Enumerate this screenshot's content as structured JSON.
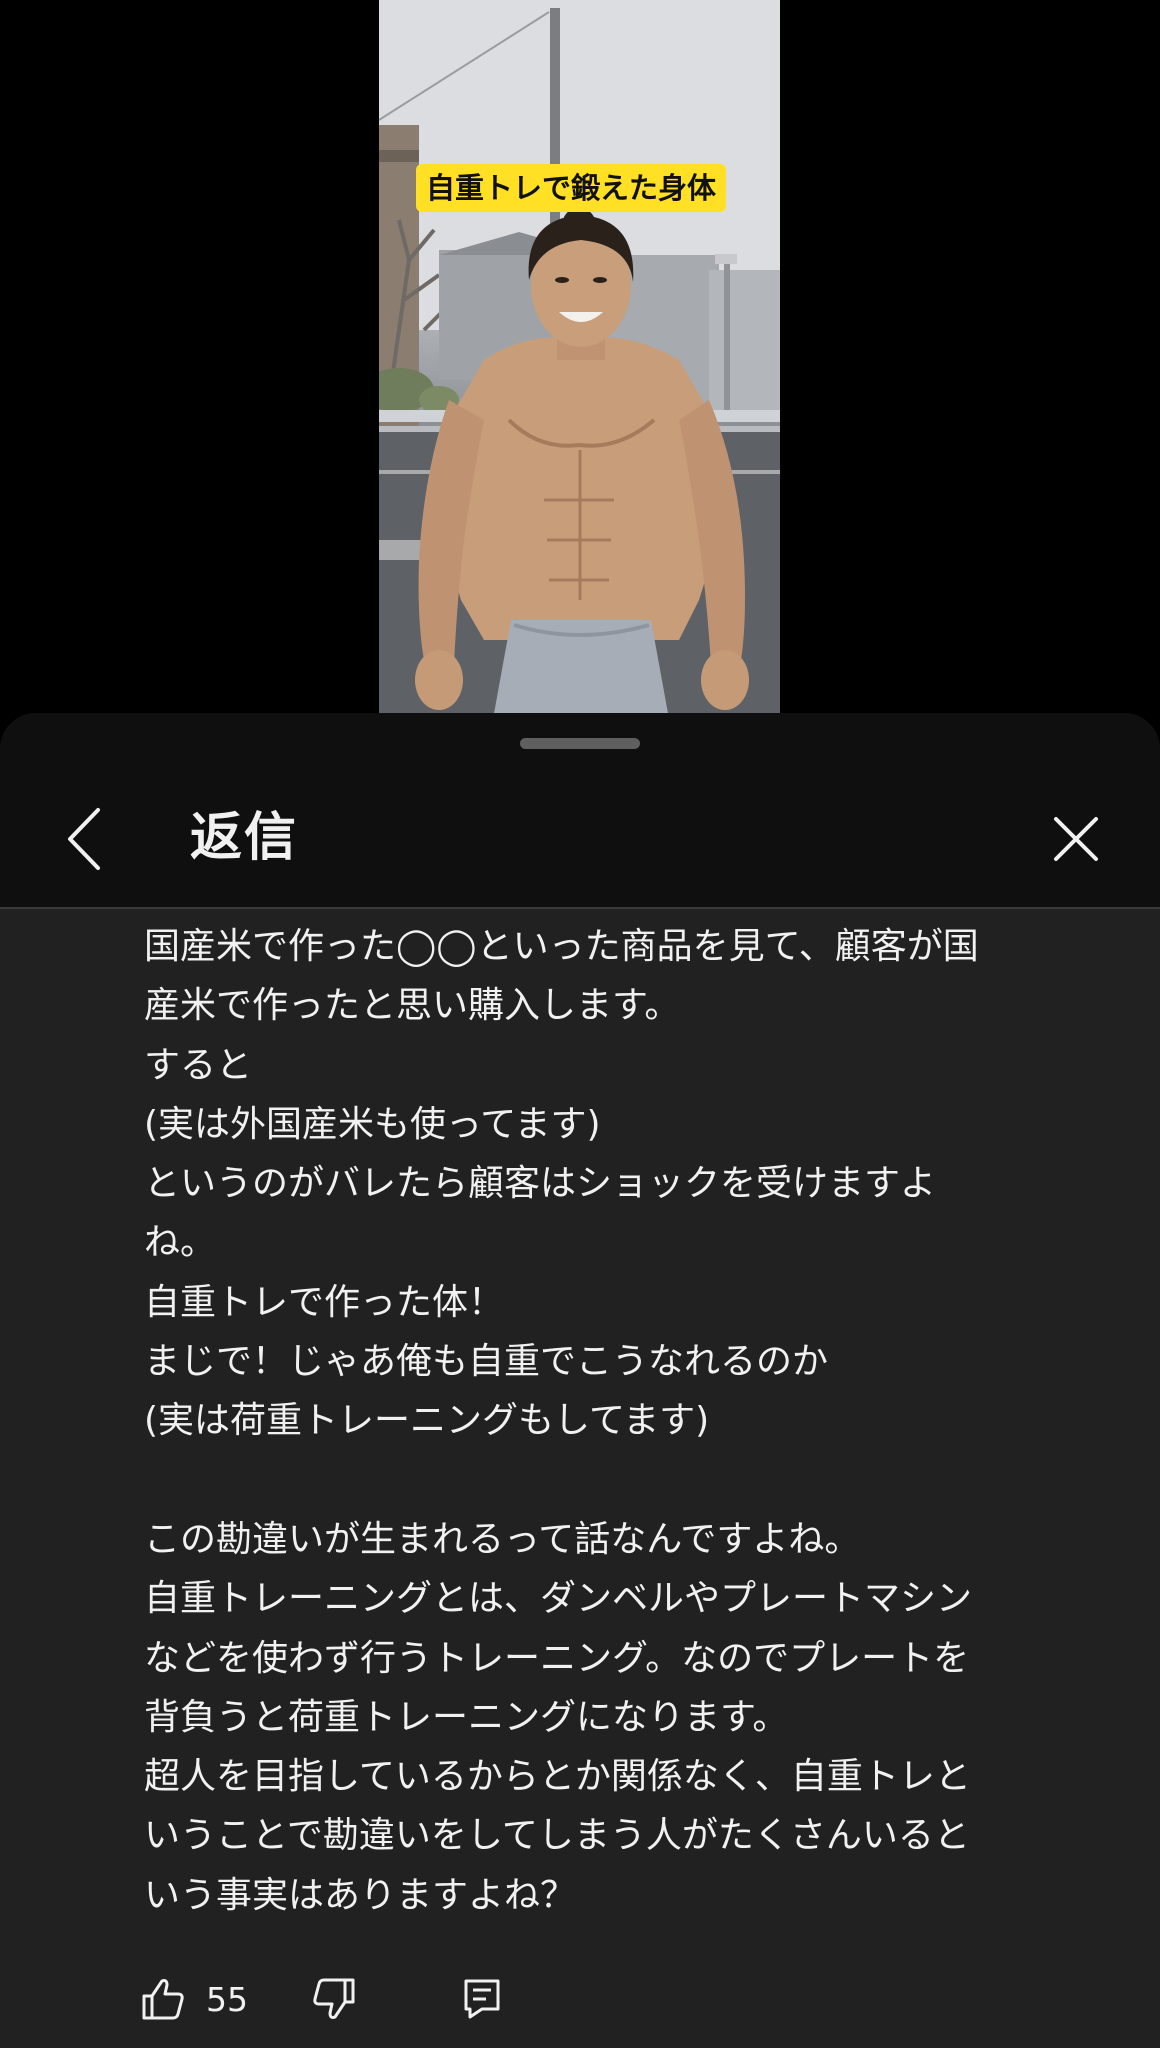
{
  "video": {
    "caption": "自重トレで鍛えた身体"
  },
  "sheet": {
    "title": "返信",
    "back_icon": "chevron-left-icon",
    "close_icon": "close-icon"
  },
  "comment": {
    "lines": [
      "国産米で作った◯◯といった商品を見て、顧客が国",
      "産米で作ったと思い購入します。",
      "すると",
      "(実は外国産米も使ってます)",
      "というのがバレたら顧客はショックを受けますよ",
      "ね。",
      "自重トレで作った体！",
      "まじで！じゃあ俺も自重でこうなれるのか",
      "(実は荷重トレーニングもしてます)",
      "",
      "この勘違いが生まれるって話なんですよね。",
      "自重トレーニングとは、ダンベルやプレートマシン",
      "などを使わず行うトレーニング。なのでプレートを",
      "背負うと荷重トレーニングになります。",
      "超人を目指しているからとか関係なく、自重トレと",
      "いうことで勘違いをしてしまう人がたくさんいると",
      "いう事実はありますよね？"
    ],
    "like_count": "55",
    "like_icon": "thumbs-up-icon",
    "dislike_icon": "thumbs-down-icon",
    "reply_icon": "reply-comment-icon"
  }
}
